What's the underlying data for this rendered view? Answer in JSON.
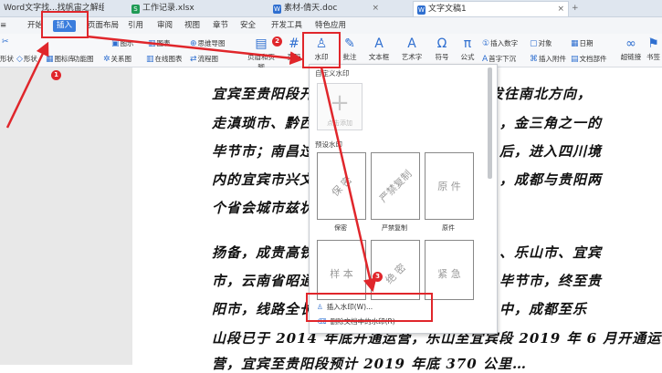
{
  "tabs": [
    {
      "label": "Word文字找...找帆宙之解组",
      "icon_color": "#2f6fd0",
      "icon": "W"
    },
    {
      "label": "工作记录.xlsx",
      "icon_color": "#1f9a55",
      "icon": "S"
    },
    {
      "label": "素材-倩天.doc",
      "icon_color": "#2f6fd0",
      "icon": "W"
    },
    {
      "label": "文字文稿1",
      "icon_color": "#2f6fd0",
      "icon": "W"
    }
  ],
  "menu": [
    "开始",
    "插入",
    "页面布局",
    "引用",
    "审阅",
    "视图",
    "章节",
    "安全",
    "开发工具",
    "特色应用"
  ],
  "ribbon": {
    "left": [
      "形状",
      "图标库",
      "功能图",
      "关系图",
      "在线图表",
      "流程图"
    ],
    "row1": [
      "图示",
      "图表",
      "思维导图"
    ],
    "big": [
      {
        "label": "页眉和页脚",
        "glyph": "▤"
      },
      {
        "label": "页码",
        "glyph": "#"
      },
      {
        "label": "水印",
        "glyph": "♙"
      },
      {
        "label": "批注",
        "glyph": "✎"
      },
      {
        "label": "文本框",
        "glyph": "A"
      },
      {
        "label": "艺术字",
        "glyph": "A"
      },
      {
        "label": "符号",
        "glyph": "Ω"
      },
      {
        "label": "公式",
        "glyph": "π"
      }
    ],
    "right": [
      "插入数字",
      "对象",
      "日期",
      "首字下沉",
      "插入附件",
      "文档部件",
      "超链接",
      "书签"
    ],
    "scissors": "✂"
  },
  "doc_lines": [
    "宜宾至贵阳段开",
    "走滇琐市、黔西",
    "毕节市；南昌过",
    "内的宜宾市兴文",
    "个省会城市兹状",
    "",
    "扬备，成贵高铁",
    "市，云南省昭通",
    "阳市，线路全长",
    "山段已于 2014 年底开通运营，乐山至宜宾段 2019 年 6 月开通运",
    "营，宜宾至贵阳段预计 2019 年底 370 公里…"
  ],
  "doc_lines_right": [
    "出发往南北方向，",
    "，金三角之一的",
    "后，进入四川境",
    "，成都与贵阳两",
    "",
    "",
    "、乐山市、宜宾",
    "毕节市，终至贵",
    "中，成都至乐"
  ],
  "dropdown": {
    "custom_header": "自定义水印",
    "add_label": "点击添加",
    "preset_header": "预设水印",
    "tiles": [
      {
        "text": "保 密",
        "caption": "保密",
        "rotated": true
      },
      {
        "text": "严禁复制",
        "caption": "严禁复制",
        "rotated": true
      },
      {
        "text": "原 件",
        "caption": "原件",
        "rotated": false
      },
      {
        "text": "样 本",
        "caption": "",
        "rotated": false
      },
      {
        "text": "绝 密",
        "caption": "",
        "rotated": true
      },
      {
        "text": "紧 急",
        "caption": "",
        "rotated": false
      }
    ],
    "insert_item": "插入水印(W)...",
    "delete_item": "删除文档中的水印(R)"
  },
  "badges": [
    "1",
    "2",
    "3"
  ],
  "colors": {
    "accent": "#3b7ddd",
    "highlight": "#e0262b",
    "icon": "#2f6fd0"
  }
}
